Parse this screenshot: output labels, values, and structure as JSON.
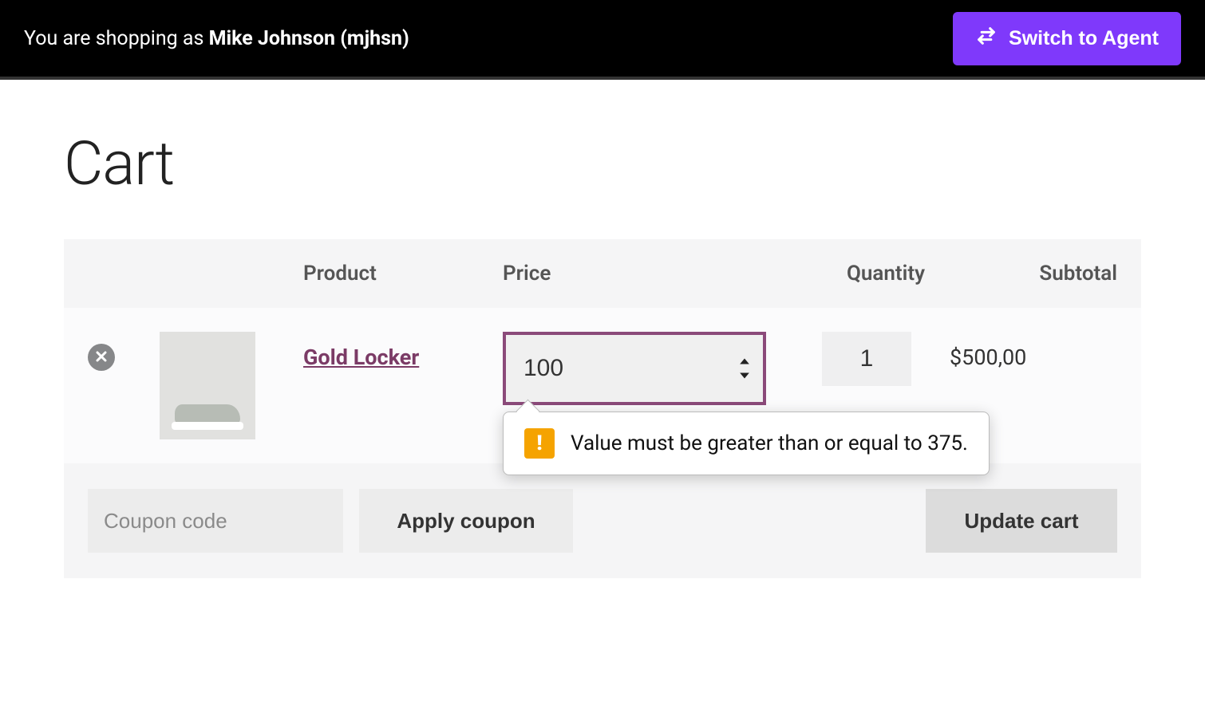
{
  "topbar": {
    "shopping_as_prefix": "You are shopping as ",
    "customer_name": "Mike Johnson (mjhsn)",
    "switch_label": "Switch to Agent"
  },
  "page": {
    "title": "Cart"
  },
  "table": {
    "headers": {
      "product": "Product",
      "price": "Price",
      "quantity": "Quantity",
      "subtotal": "Subtotal"
    }
  },
  "item": {
    "name": "Gold Locker",
    "price_value": "100",
    "quantity_value": "1",
    "subtotal": "$500,00"
  },
  "validation": {
    "message": "Value must be greater than or equal to 375."
  },
  "actions": {
    "coupon_placeholder": "Coupon code",
    "apply_label": "Apply coupon",
    "update_label": "Update cart"
  }
}
